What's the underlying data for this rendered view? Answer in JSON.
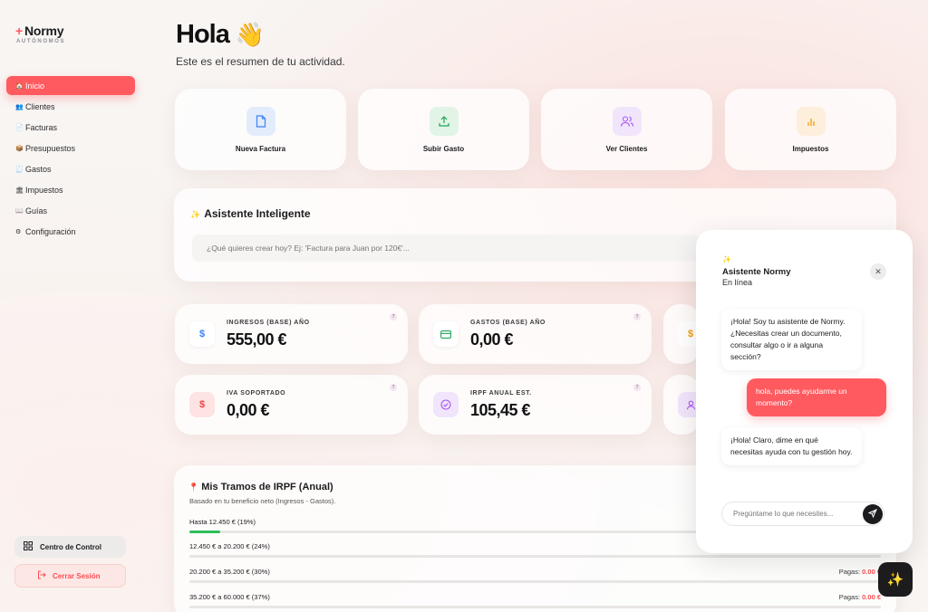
{
  "brand": {
    "name": "Normy",
    "sub": "AUTÓNOMOS"
  },
  "sidebar": {
    "items": [
      {
        "emoji": "🏠",
        "label": "Inicio",
        "active": true
      },
      {
        "emoji": "👥",
        "label": "Clientes"
      },
      {
        "emoji": "📄",
        "label": "Facturas"
      },
      {
        "emoji": "📦",
        "label": "Presupuestos"
      },
      {
        "emoji": "🧾",
        "label": "Gastos"
      },
      {
        "emoji": "🏛",
        "label": "Impuestos"
      },
      {
        "emoji": "📖",
        "label": "Guías"
      },
      {
        "emoji": "⚙",
        "label": "Configuración"
      }
    ],
    "control_label": "Centro de Control",
    "logout_label": "Cerrar Sesión"
  },
  "header": {
    "greeting": "Hola",
    "wave": "👋",
    "subtitle": "Este es el resumen de tu actividad."
  },
  "quick_actions": [
    {
      "label": "Nueva Factura",
      "icon": "document-icon",
      "color": "#3b82f6"
    },
    {
      "label": "Subir Gasto",
      "icon": "upload-icon",
      "color": "#22a35a"
    },
    {
      "label": "Ver Clientes",
      "icon": "users-icon",
      "color": "#a855f7"
    },
    {
      "label": "Impuestos",
      "icon": "bar-chart-icon",
      "color": "#f59e0b"
    }
  ],
  "assistant": {
    "spark": "✨",
    "title": "Asistente Inteligente",
    "placeholder": "¿Qué quieres crear hoy? Ej: 'Factura para Juan por 120€'..."
  },
  "stats": [
    {
      "label": "INGRESOS (BASE) AÑO",
      "value": "555,00 €",
      "icon": "dollar-icon",
      "q": "?"
    },
    {
      "label": "GASTOS (BASE) AÑO",
      "value": "0,00 €",
      "icon": "card-icon",
      "q": "?"
    },
    {
      "label": "IVA SOPORTADO",
      "value": "0,00 €",
      "icon": "dollar-icon",
      "q": "?"
    },
    {
      "label": "IRPF ANUAL EST.",
      "value": "105,45 €",
      "icon": "check-icon",
      "q": "?"
    }
  ],
  "irpf": {
    "pin": "📍",
    "title": "Mis Tramos de IRPF (Anual)",
    "subtitle": "Basado en tu beneficio neto (Ingresos - Gastos).",
    "tramos": [
      {
        "label": "Hasta 12.450 € (19%)",
        "fill": 0.045,
        "paid_label": "",
        "paid_value": ""
      },
      {
        "label": "12.450 € a 20.200 € (24%)",
        "fill": 0,
        "paid_label": "",
        "paid_value": ""
      },
      {
        "label": "20.200 € a 35.200 € (30%)",
        "fill": 0,
        "paid_label": "Pagas:",
        "paid_value": "0.00 €"
      },
      {
        "label": "35.200 € a 60.000 € (37%)",
        "fill": 0,
        "paid_label": "Pagas:",
        "paid_value": "0.00 €"
      }
    ]
  },
  "chat": {
    "spark": "✨",
    "title": "Asistente Normy",
    "status": "En línea",
    "close": "✕",
    "messages": [
      {
        "from": "bot",
        "text": "¡Hola! Soy tu asistente de Normy. ¿Necesitas crear un documento, consultar algo o ir a alguna sección?"
      },
      {
        "from": "user",
        "text": "hola, puedes ayudarme un momento?"
      },
      {
        "from": "bot",
        "text": "¡Hola! Claro, dime en qué necesitas ayuda con tu gestión hoy."
      }
    ],
    "placeholder": "Pregúntame lo que necesites..."
  },
  "fab": {
    "icon": "✨"
  }
}
